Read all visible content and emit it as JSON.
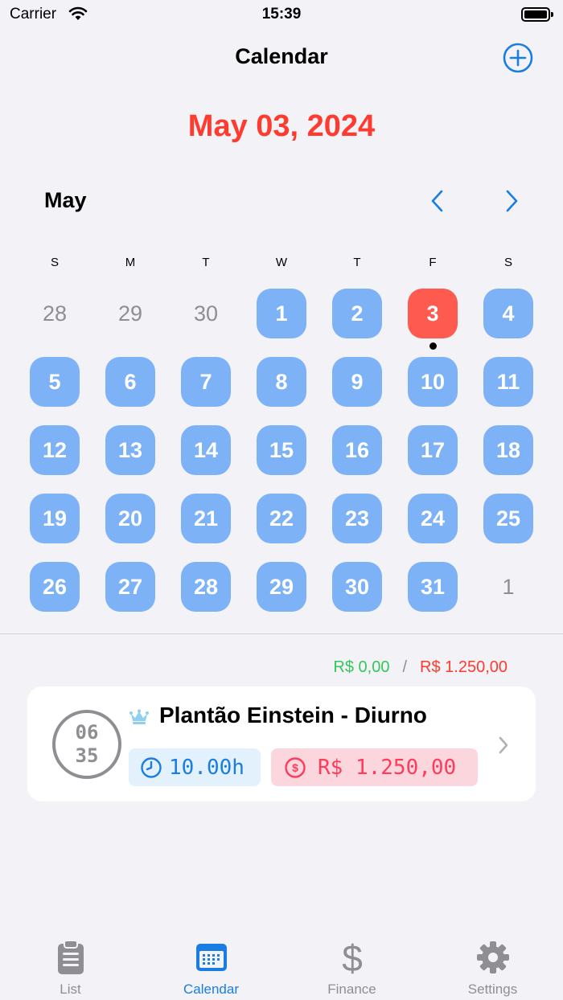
{
  "status_bar": {
    "carrier": "Carrier",
    "time": "15:39"
  },
  "nav": {
    "title": "Calendar",
    "add_icon": "plus-circle-icon"
  },
  "selected_date": "May 03, 2024",
  "calendar": {
    "month": "May",
    "weekdays": [
      "S",
      "M",
      "T",
      "W",
      "T",
      "F",
      "S"
    ],
    "weeks": [
      [
        {
          "d": "28",
          "s": "out"
        },
        {
          "d": "29",
          "s": "out"
        },
        {
          "d": "30",
          "s": "out"
        },
        {
          "d": "1",
          "s": "in"
        },
        {
          "d": "2",
          "s": "in"
        },
        {
          "d": "3",
          "s": "today",
          "event": true
        },
        {
          "d": "4",
          "s": "in"
        }
      ],
      [
        {
          "d": "5",
          "s": "in"
        },
        {
          "d": "6",
          "s": "in"
        },
        {
          "d": "7",
          "s": "in"
        },
        {
          "d": "8",
          "s": "in"
        },
        {
          "d": "9",
          "s": "in"
        },
        {
          "d": "10",
          "s": "in"
        },
        {
          "d": "11",
          "s": "in"
        }
      ],
      [
        {
          "d": "12",
          "s": "in"
        },
        {
          "d": "13",
          "s": "in"
        },
        {
          "d": "14",
          "s": "in"
        },
        {
          "d": "15",
          "s": "in"
        },
        {
          "d": "16",
          "s": "in"
        },
        {
          "d": "17",
          "s": "in"
        },
        {
          "d": "18",
          "s": "in"
        }
      ],
      [
        {
          "d": "19",
          "s": "in"
        },
        {
          "d": "20",
          "s": "in"
        },
        {
          "d": "21",
          "s": "in"
        },
        {
          "d": "22",
          "s": "in"
        },
        {
          "d": "23",
          "s": "in"
        },
        {
          "d": "24",
          "s": "in"
        },
        {
          "d": "25",
          "s": "in"
        }
      ],
      [
        {
          "d": "26",
          "s": "in"
        },
        {
          "d": "27",
          "s": "in"
        },
        {
          "d": "28",
          "s": "in"
        },
        {
          "d": "29",
          "s": "in"
        },
        {
          "d": "30",
          "s": "in"
        },
        {
          "d": "31",
          "s": "in"
        },
        {
          "d": "1",
          "s": "out"
        }
      ]
    ]
  },
  "totals": {
    "earned": "R$ 0,00",
    "separator": "/",
    "expected": "R$ 1.250,00"
  },
  "shift": {
    "start_hour": "06",
    "start_minute": "35",
    "title": "Plantão Einstein - Diurno",
    "hours": "10.00h",
    "value": "R$ 1.250,00"
  },
  "tabs": [
    {
      "label": "List",
      "icon": "clipboard-icon"
    },
    {
      "label": "Calendar",
      "icon": "calendar-icon",
      "active": true
    },
    {
      "label": "Finance",
      "icon": "dollar-icon"
    },
    {
      "label": "Settings",
      "icon": "gear-icon"
    }
  ],
  "colors": {
    "accent": "#1a7de2",
    "today": "#ff5a50",
    "day": "#7db3f6",
    "earned": "#34c759",
    "expected": "#ff3b30"
  }
}
